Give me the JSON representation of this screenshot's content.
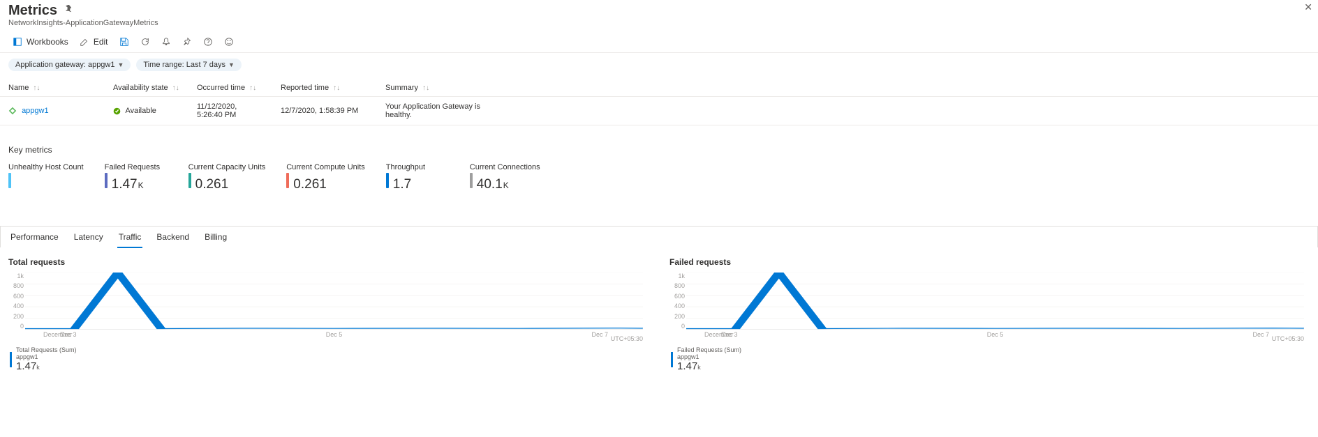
{
  "header": {
    "title": "Metrics",
    "subtitle": "NetworkInsights-ApplicationGatewayMetrics"
  },
  "toolbar": {
    "workbooks": "Workbooks",
    "edit": "Edit"
  },
  "filters": {
    "gateway": "Application gateway: appgw1",
    "timerange": "Time range: Last 7 days"
  },
  "table": {
    "cols": {
      "name": "Name",
      "avail": "Availability state",
      "occurred": "Occurred time",
      "reported": "Reported time",
      "summary": "Summary"
    },
    "row": {
      "name": "appgw1",
      "avail": "Available",
      "occurred": "11/12/2020, 5:26:40 PM",
      "reported": "12/7/2020, 1:58:39 PM",
      "summary": "Your Application Gateway is healthy."
    }
  },
  "keymetrics_title": "Key metrics",
  "kpis": [
    {
      "title": "Unhealthy Host Count",
      "value": "",
      "unit": "",
      "color": "#4fc3f7"
    },
    {
      "title": "Failed Requests",
      "value": "1.47",
      "unit": "K",
      "color": "#5c6bc0"
    },
    {
      "title": "Current Capacity Units",
      "value": "0.261",
      "unit": "",
      "color": "#26a69a"
    },
    {
      "title": "Current Compute Units",
      "value": "0.261",
      "unit": "",
      "color": "#ef6c5a"
    },
    {
      "title": "Throughput",
      "value": "1.7",
      "unit": "",
      "color": "#0078d4"
    },
    {
      "title": "Current Connections",
      "value": "40.1",
      "unit": "K",
      "color": "#9e9e9e"
    }
  ],
  "tabs": [
    "Performance",
    "Latency",
    "Traffic",
    "Backend",
    "Billing"
  ],
  "active_tab": "Traffic",
  "chart_data": [
    {
      "title": "Total requests",
      "type": "line",
      "ylim": [
        0,
        1000
      ],
      "yticks": [
        "1k",
        "800",
        "600",
        "400",
        "200",
        "0"
      ],
      "xticks": [
        "December",
        "Dec 3",
        "Dec 5",
        "Dec 7"
      ],
      "tz": "UTC+05:30",
      "series": [
        {
          "name": "Total Requests (Sum)",
          "sub": "appgw1",
          "value": "1.47",
          "unit": "k",
          "points": [
            [
              0,
              18
            ],
            [
              8,
              18
            ],
            [
              15,
              1000
            ],
            [
              22,
              18
            ],
            [
              35,
              25
            ],
            [
              50,
              22
            ],
            [
              65,
              25
            ],
            [
              80,
              22
            ],
            [
              95,
              28
            ],
            [
              100,
              25
            ]
          ]
        }
      ]
    },
    {
      "title": "Failed requests",
      "type": "line",
      "ylim": [
        0,
        1000
      ],
      "yticks": [
        "1k",
        "800",
        "600",
        "400",
        "200",
        "0"
      ],
      "xticks": [
        "December",
        "Dec 3",
        "Dec 5",
        "Dec 7"
      ],
      "tz": "UTC+05:30",
      "series": [
        {
          "name": "Failed Requests (Sum)",
          "sub": "appgw1",
          "value": "1.47",
          "unit": "k",
          "points": [
            [
              0,
              18
            ],
            [
              8,
              18
            ],
            [
              15,
              1000
            ],
            [
              22,
              18
            ],
            [
              35,
              25
            ],
            [
              50,
              22
            ],
            [
              65,
              25
            ],
            [
              80,
              22
            ],
            [
              95,
              28
            ],
            [
              100,
              25
            ]
          ]
        }
      ]
    }
  ]
}
